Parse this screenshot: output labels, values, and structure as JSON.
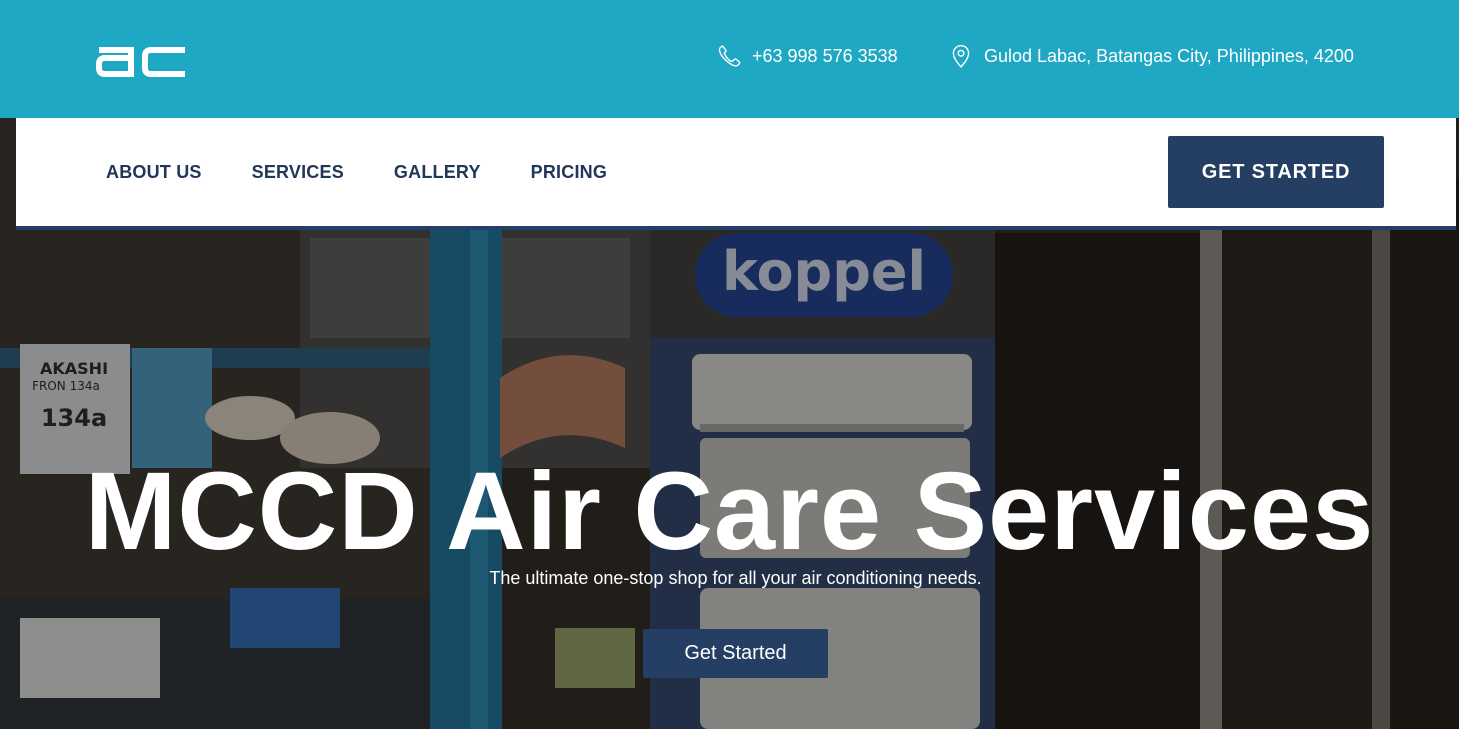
{
  "header": {
    "logo_text": "ac",
    "phone": "+63 998 576 3538",
    "address": "Gulod Labac, Batangas City, Philippines, 4200",
    "icons": {
      "phone": "phone-icon",
      "location": "location-pin-icon"
    },
    "background_color": "#1fa8c4"
  },
  "nav": {
    "items": [
      {
        "label": "ABOUT US"
      },
      {
        "label": "SERVICES"
      },
      {
        "label": "GALLERY"
      },
      {
        "label": "PRICING"
      }
    ],
    "cta_label": "GET STARTED",
    "accent_color": "#243f63"
  },
  "hero": {
    "title": "MCCD Air Care Services",
    "subtitle": "The ultimate one-stop shop for all your air conditioning needs.",
    "cta_label": "Get Started",
    "photo_text": {
      "brand_sign": "koppel",
      "box_brand": "AKASHI",
      "box_line": "FRON 134a",
      "box_code": "134a"
    }
  }
}
